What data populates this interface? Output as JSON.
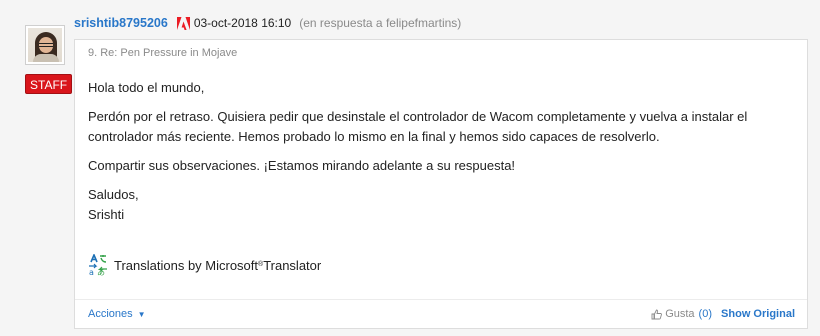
{
  "author": {
    "username": "srishtib8795206",
    "badge": "STAFF"
  },
  "header": {
    "timestamp": "03-oct-2018 16:10",
    "reply_to": "(en respuesta a felipefmartins)"
  },
  "post": {
    "subject": "9. Re: Pen Pressure in Mojave",
    "paragraphs": [
      "Hola todo el mundo,",
      "Perdón por el retraso. Quisiera pedir que desinstale el controlador de Wacom completamente y vuelva a instalar el controlador más reciente. Hemos probado lo mismo en la final y hemos sido capaces de resolverlo.",
      "Compartir sus observaciones. ¡Estamos mirando adelante a su respuesta!"
    ],
    "signoff": "Saludos,",
    "signature": "Srishti"
  },
  "translator": {
    "prefix": "Translations by Microsoft",
    "reg": "®",
    "suffix": " Translator"
  },
  "footer": {
    "actions_label": "Acciones",
    "like_label": "Gusta",
    "like_count": "(0)",
    "show_original_label": "Show Original"
  },
  "colors": {
    "link": "#2977c9",
    "staff_badge": "#d9151b",
    "adobe_red": "#eb1c24"
  }
}
